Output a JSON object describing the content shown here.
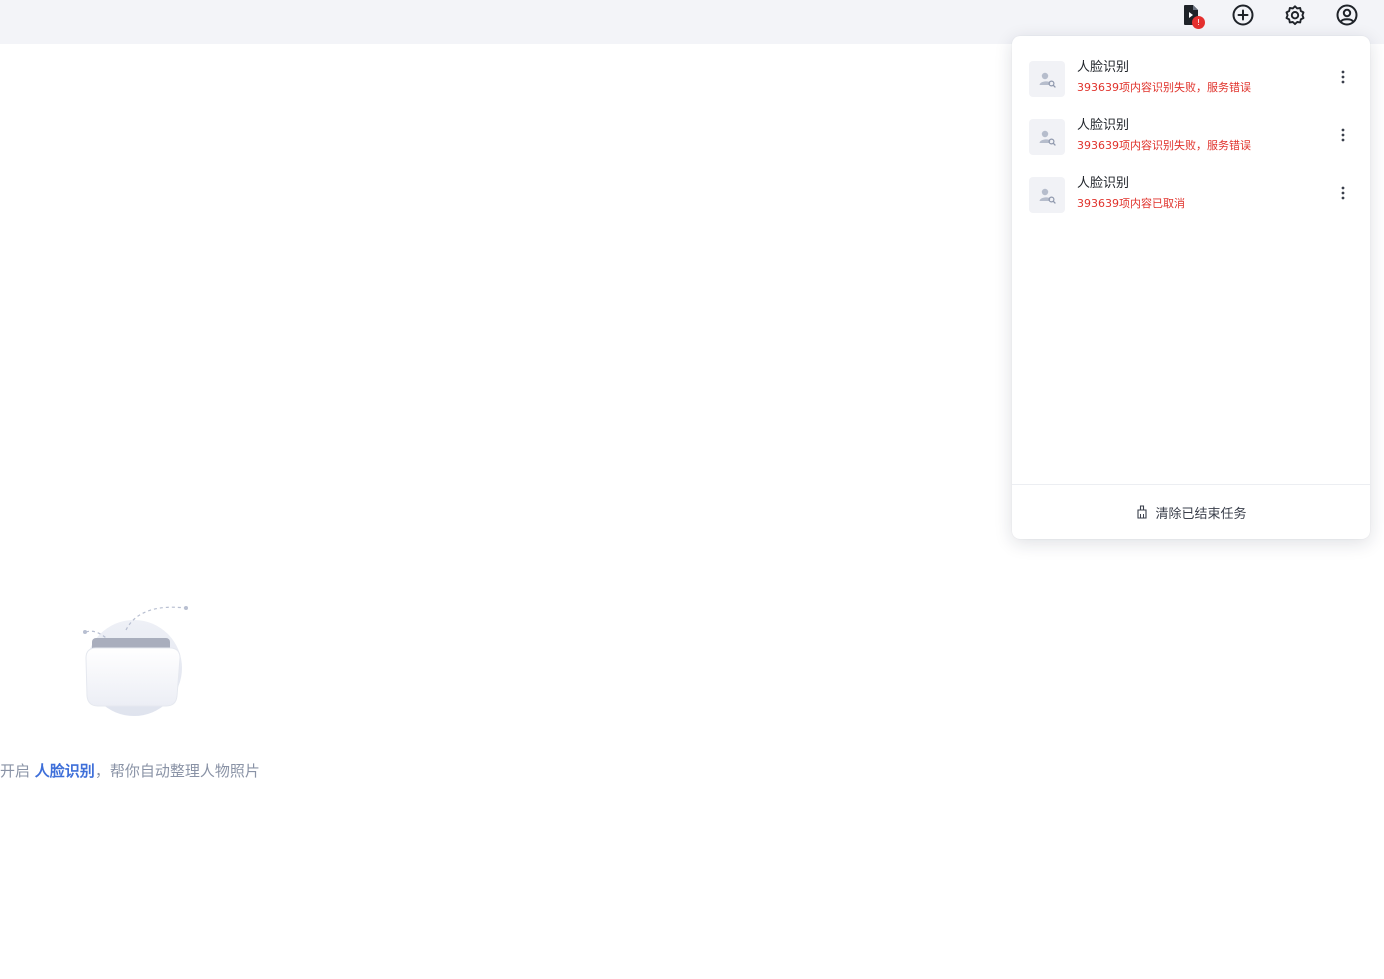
{
  "header": {
    "icons": [
      {
        "name": "task-list-icon",
        "badge": "!"
      },
      {
        "name": "add-circle-icon"
      },
      {
        "name": "gear-icon"
      },
      {
        "name": "user-avatar-icon"
      }
    ]
  },
  "empty_state": {
    "prefix": "开启",
    "link": "人脸识别",
    "suffix": "，帮你自动整理人物照片"
  },
  "task_panel": {
    "tasks": [
      {
        "title": "人脸识别",
        "status": "393639项内容识别失败，服务错误"
      },
      {
        "title": "人脸识别",
        "status": "393639项内容识别失败，服务错误"
      },
      {
        "title": "人脸识别",
        "status": "393639项内容已取消"
      }
    ],
    "clear_label": "清除已结束任务"
  },
  "colors": {
    "accent": "#3e6fd9",
    "error": "#e0322b",
    "header_bg": "#f3f4f8"
  }
}
